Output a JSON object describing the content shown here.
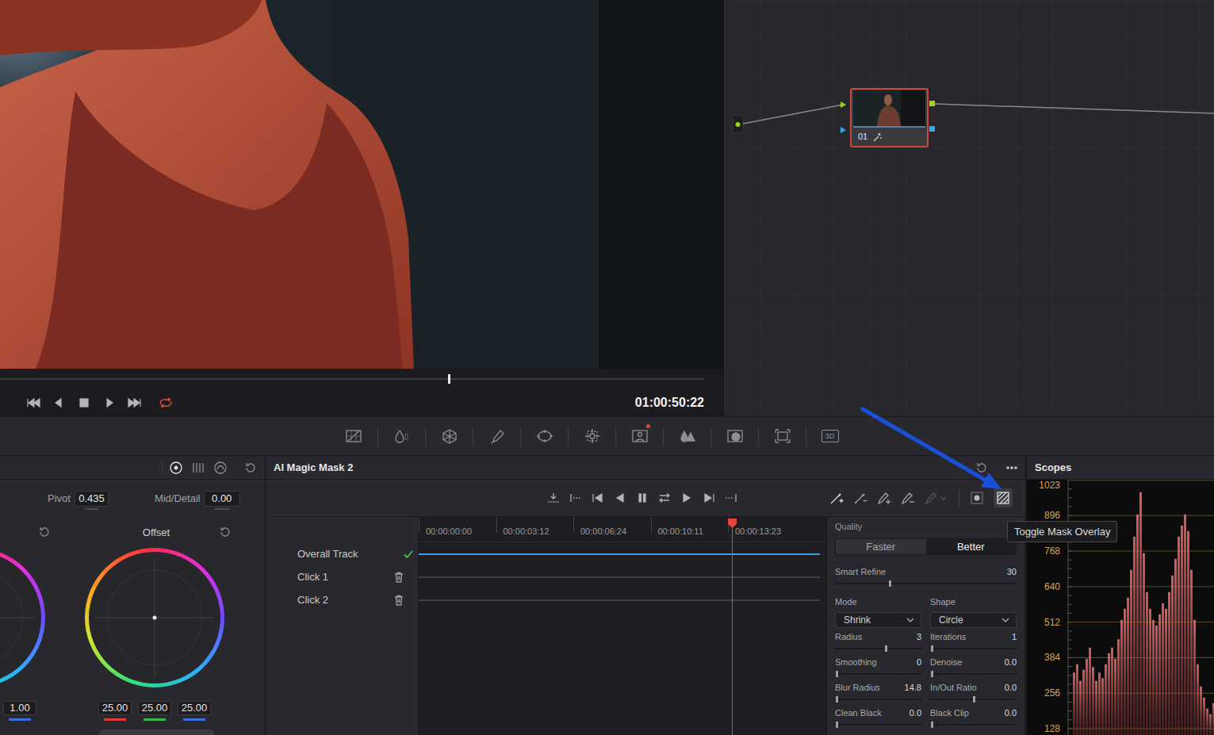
{
  "viewer": {
    "timecode": "01:00:50:22",
    "level": 0.636,
    "loop": true
  },
  "node_editor": {
    "nodes": [
      {
        "label": "01",
        "selected": true
      }
    ]
  },
  "palette": {
    "tools": [
      {
        "badge": false
      },
      {
        "badge": false
      },
      {
        "badge": false
      },
      {
        "badge": false
      },
      {
        "badge": false
      },
      {
        "badge": false
      },
      {
        "badge": true
      },
      {
        "badge": false
      },
      {
        "badge": false
      },
      {
        "badge": false
      },
      {
        "badge": false,
        "label": "3D"
      }
    ]
  },
  "primaries": {
    "modes": [
      {
        "selected": true
      },
      {
        "selected": false
      },
      {
        "selected": false
      }
    ],
    "pivot": {
      "label": "Pivot",
      "value": "0.435"
    },
    "mid_detail": {
      "label": "Mid/Detail",
      "value": "0.00"
    },
    "partial_wheel": {
      "values": [
        {
          "text": "1.00",
          "color": "#3b6fe0"
        }
      ]
    },
    "offset_wheel": {
      "title": "Offset",
      "values": [
        {
          "text": "25.00",
          "color": "#e03a3a"
        },
        {
          "text": "25.00",
          "color": "#38b84a"
        },
        {
          "text": "25.00",
          "color": "#3b6fe0"
        }
      ]
    }
  },
  "magic_mask": {
    "title": "AI Magic Mask 2",
    "stroke_tools": [
      {
        "disabled": false
      },
      {
        "disabled": false
      },
      {
        "disabled": false
      },
      {
        "disabled": false
      },
      {
        "disabled": true
      }
    ],
    "toggles": [
      {
        "kind": "show",
        "hovered": false
      },
      {
        "kind": "overlay",
        "hovered": true
      }
    ],
    "tooltip": "Toggle Mask Overlay",
    "ruler": [
      "00:00:00:00",
      "00:00:03:12",
      "00:00:06:24",
      "00:00:10:11",
      "00:00:13:23"
    ],
    "playhead": 0.768,
    "tracks": [
      {
        "label": "Overall Track",
        "kind": "overall",
        "tracked": true,
        "level": 0.984
      },
      {
        "label": "Click 1",
        "kind": "click",
        "tracked": false,
        "level": 0.984
      },
      {
        "label": "Click 2",
        "kind": "click",
        "tracked": false,
        "level": 0.984
      }
    ],
    "settings": {
      "quality": {
        "label": "Quality",
        "options": [
          {
            "label": "Faster",
            "selected": false
          },
          {
            "label": "Better",
            "selected": true
          }
        ]
      },
      "smart_refine": {
        "label": "Smart Refine",
        "value": "30",
        "level": 0.3
      },
      "dropdowns": [
        {
          "label": "Mode",
          "value": "Shrink"
        },
        {
          "label": "Shape",
          "value": "Circle"
        }
      ],
      "sliders": [
        {
          "label": "Radius",
          "value": "3",
          "level": 0.59
        },
        {
          "label": "Iterations",
          "value": "1",
          "level": 0.02
        },
        {
          "label": "Smoothing",
          "value": "0",
          "level": 0.02
        },
        {
          "label": "Denoise",
          "value": "0.0",
          "level": 0.02
        },
        {
          "label": "Blur Radius",
          "value": "14.8",
          "level": 0.02
        },
        {
          "label": "In/Out Ratio",
          "value": "0.0",
          "level": 0.5
        },
        {
          "label": "Clean Black",
          "value": "0.0",
          "level": 0.02
        },
        {
          "label": "Black Clip",
          "value": "0.0",
          "level": 0.02
        }
      ]
    }
  },
  "scopes": {
    "title": "Scopes",
    "ticks": [
      "1023",
      "896",
      "768",
      "640",
      "512",
      "384",
      "256",
      "128"
    ],
    "waveform": [
      330,
      360,
      300,
      340,
      380,
      420,
      350,
      300,
      330,
      310,
      360,
      400,
      420,
      380,
      450,
      520,
      560,
      600,
      700,
      820,
      900,
      980,
      760,
      620,
      560,
      520,
      500,
      540,
      580,
      560,
      620,
      680,
      740,
      820,
      860,
      900,
      840,
      700,
      520,
      360,
      280,
      240,
      200,
      180,
      220,
      190
    ]
  }
}
